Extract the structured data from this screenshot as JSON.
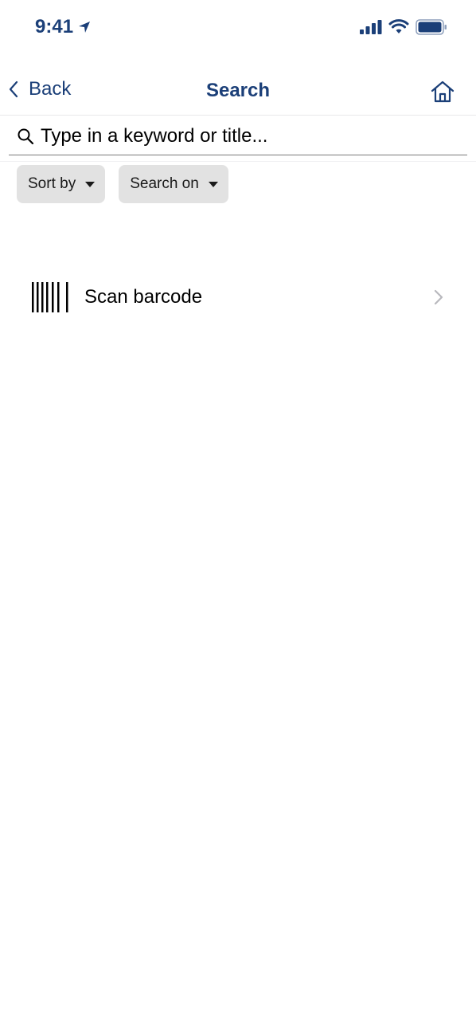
{
  "status_bar": {
    "time": "9:41",
    "icons": [
      "location-arrow-icon",
      "cellular-signal-icon",
      "wifi-icon",
      "battery-icon"
    ]
  },
  "nav": {
    "back_label": "Back",
    "title": "Search",
    "home_icon": "home-icon"
  },
  "search": {
    "placeholder": "Type in a keyword or title...",
    "value": ""
  },
  "filters": [
    {
      "label": "Sort by"
    },
    {
      "label": "Search on"
    }
  ],
  "scan": {
    "label": "Scan barcode",
    "icon": "barcode-icon"
  },
  "colors": {
    "accent": "#1b3f78",
    "filter_bg": "#e2e2e2",
    "chevron": "#b8b8bd"
  }
}
